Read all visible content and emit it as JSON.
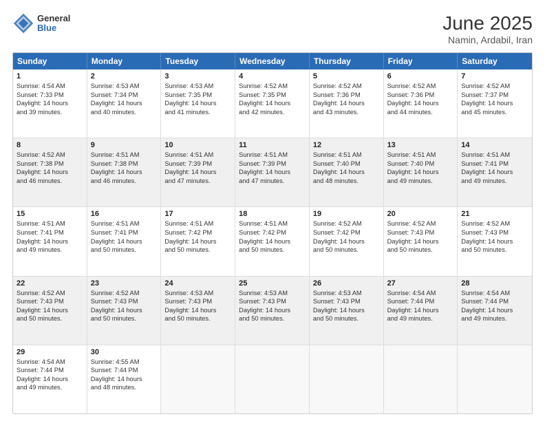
{
  "header": {
    "logo_line1": "General",
    "logo_line2": "Blue",
    "title": "June 2025",
    "subtitle": "Namin, Ardabil, Iran"
  },
  "weekdays": [
    "Sunday",
    "Monday",
    "Tuesday",
    "Wednesday",
    "Thursday",
    "Friday",
    "Saturday"
  ],
  "rows": [
    [
      {
        "day": "1",
        "lines": [
          "Sunrise: 4:54 AM",
          "Sunset: 7:33 PM",
          "Daylight: 14 hours",
          "and 39 minutes."
        ]
      },
      {
        "day": "2",
        "lines": [
          "Sunrise: 4:53 AM",
          "Sunset: 7:34 PM",
          "Daylight: 14 hours",
          "and 40 minutes."
        ]
      },
      {
        "day": "3",
        "lines": [
          "Sunrise: 4:53 AM",
          "Sunset: 7:35 PM",
          "Daylight: 14 hours",
          "and 41 minutes."
        ]
      },
      {
        "day": "4",
        "lines": [
          "Sunrise: 4:52 AM",
          "Sunset: 7:35 PM",
          "Daylight: 14 hours",
          "and 42 minutes."
        ]
      },
      {
        "day": "5",
        "lines": [
          "Sunrise: 4:52 AM",
          "Sunset: 7:36 PM",
          "Daylight: 14 hours",
          "and 43 minutes."
        ]
      },
      {
        "day": "6",
        "lines": [
          "Sunrise: 4:52 AM",
          "Sunset: 7:36 PM",
          "Daylight: 14 hours",
          "and 44 minutes."
        ]
      },
      {
        "day": "7",
        "lines": [
          "Sunrise: 4:52 AM",
          "Sunset: 7:37 PM",
          "Daylight: 14 hours",
          "and 45 minutes."
        ]
      }
    ],
    [
      {
        "day": "8",
        "lines": [
          "Sunrise: 4:52 AM",
          "Sunset: 7:38 PM",
          "Daylight: 14 hours",
          "and 46 minutes."
        ]
      },
      {
        "day": "9",
        "lines": [
          "Sunrise: 4:51 AM",
          "Sunset: 7:38 PM",
          "Daylight: 14 hours",
          "and 46 minutes."
        ]
      },
      {
        "day": "10",
        "lines": [
          "Sunrise: 4:51 AM",
          "Sunset: 7:39 PM",
          "Daylight: 14 hours",
          "and 47 minutes."
        ]
      },
      {
        "day": "11",
        "lines": [
          "Sunrise: 4:51 AM",
          "Sunset: 7:39 PM",
          "Daylight: 14 hours",
          "and 47 minutes."
        ]
      },
      {
        "day": "12",
        "lines": [
          "Sunrise: 4:51 AM",
          "Sunset: 7:40 PM",
          "Daylight: 14 hours",
          "and 48 minutes."
        ]
      },
      {
        "day": "13",
        "lines": [
          "Sunrise: 4:51 AM",
          "Sunset: 7:40 PM",
          "Daylight: 14 hours",
          "and 49 minutes."
        ]
      },
      {
        "day": "14",
        "lines": [
          "Sunrise: 4:51 AM",
          "Sunset: 7:41 PM",
          "Daylight: 14 hours",
          "and 49 minutes."
        ]
      }
    ],
    [
      {
        "day": "15",
        "lines": [
          "Sunrise: 4:51 AM",
          "Sunset: 7:41 PM",
          "Daylight: 14 hours",
          "and 49 minutes."
        ]
      },
      {
        "day": "16",
        "lines": [
          "Sunrise: 4:51 AM",
          "Sunset: 7:41 PM",
          "Daylight: 14 hours",
          "and 50 minutes."
        ]
      },
      {
        "day": "17",
        "lines": [
          "Sunrise: 4:51 AM",
          "Sunset: 7:42 PM",
          "Daylight: 14 hours",
          "and 50 minutes."
        ]
      },
      {
        "day": "18",
        "lines": [
          "Sunrise: 4:51 AM",
          "Sunset: 7:42 PM",
          "Daylight: 14 hours",
          "and 50 minutes."
        ]
      },
      {
        "day": "19",
        "lines": [
          "Sunrise: 4:52 AM",
          "Sunset: 7:42 PM",
          "Daylight: 14 hours",
          "and 50 minutes."
        ]
      },
      {
        "day": "20",
        "lines": [
          "Sunrise: 4:52 AM",
          "Sunset: 7:43 PM",
          "Daylight: 14 hours",
          "and 50 minutes."
        ]
      },
      {
        "day": "21",
        "lines": [
          "Sunrise: 4:52 AM",
          "Sunset: 7:43 PM",
          "Daylight: 14 hours",
          "and 50 minutes."
        ]
      }
    ],
    [
      {
        "day": "22",
        "lines": [
          "Sunrise: 4:52 AM",
          "Sunset: 7:43 PM",
          "Daylight: 14 hours",
          "and 50 minutes."
        ]
      },
      {
        "day": "23",
        "lines": [
          "Sunrise: 4:52 AM",
          "Sunset: 7:43 PM",
          "Daylight: 14 hours",
          "and 50 minutes."
        ]
      },
      {
        "day": "24",
        "lines": [
          "Sunrise: 4:53 AM",
          "Sunset: 7:43 PM",
          "Daylight: 14 hours",
          "and 50 minutes."
        ]
      },
      {
        "day": "25",
        "lines": [
          "Sunrise: 4:53 AM",
          "Sunset: 7:43 PM",
          "Daylight: 14 hours",
          "and 50 minutes."
        ]
      },
      {
        "day": "26",
        "lines": [
          "Sunrise: 4:53 AM",
          "Sunset: 7:43 PM",
          "Daylight: 14 hours",
          "and 50 minutes."
        ]
      },
      {
        "day": "27",
        "lines": [
          "Sunrise: 4:54 AM",
          "Sunset: 7:44 PM",
          "Daylight: 14 hours",
          "and 49 minutes."
        ]
      },
      {
        "day": "28",
        "lines": [
          "Sunrise: 4:54 AM",
          "Sunset: 7:44 PM",
          "Daylight: 14 hours",
          "and 49 minutes."
        ]
      }
    ],
    [
      {
        "day": "29",
        "lines": [
          "Sunrise: 4:54 AM",
          "Sunset: 7:44 PM",
          "Daylight: 14 hours",
          "and 49 minutes."
        ]
      },
      {
        "day": "30",
        "lines": [
          "Sunrise: 4:55 AM",
          "Sunset: 7:44 PM",
          "Daylight: 14 hours",
          "and 48 minutes."
        ]
      },
      {
        "day": "",
        "lines": []
      },
      {
        "day": "",
        "lines": []
      },
      {
        "day": "",
        "lines": []
      },
      {
        "day": "",
        "lines": []
      },
      {
        "day": "",
        "lines": []
      }
    ]
  ]
}
